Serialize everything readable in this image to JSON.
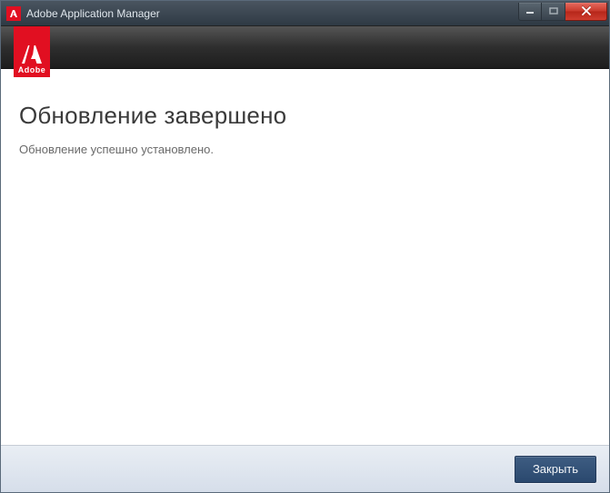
{
  "titlebar": {
    "title": "Adobe Application Manager"
  },
  "logo": {
    "brand": "Adobe"
  },
  "content": {
    "heading": "Обновление завершено",
    "message": "Обновление успешно установлено."
  },
  "footer": {
    "close_label": "Закрыть"
  }
}
